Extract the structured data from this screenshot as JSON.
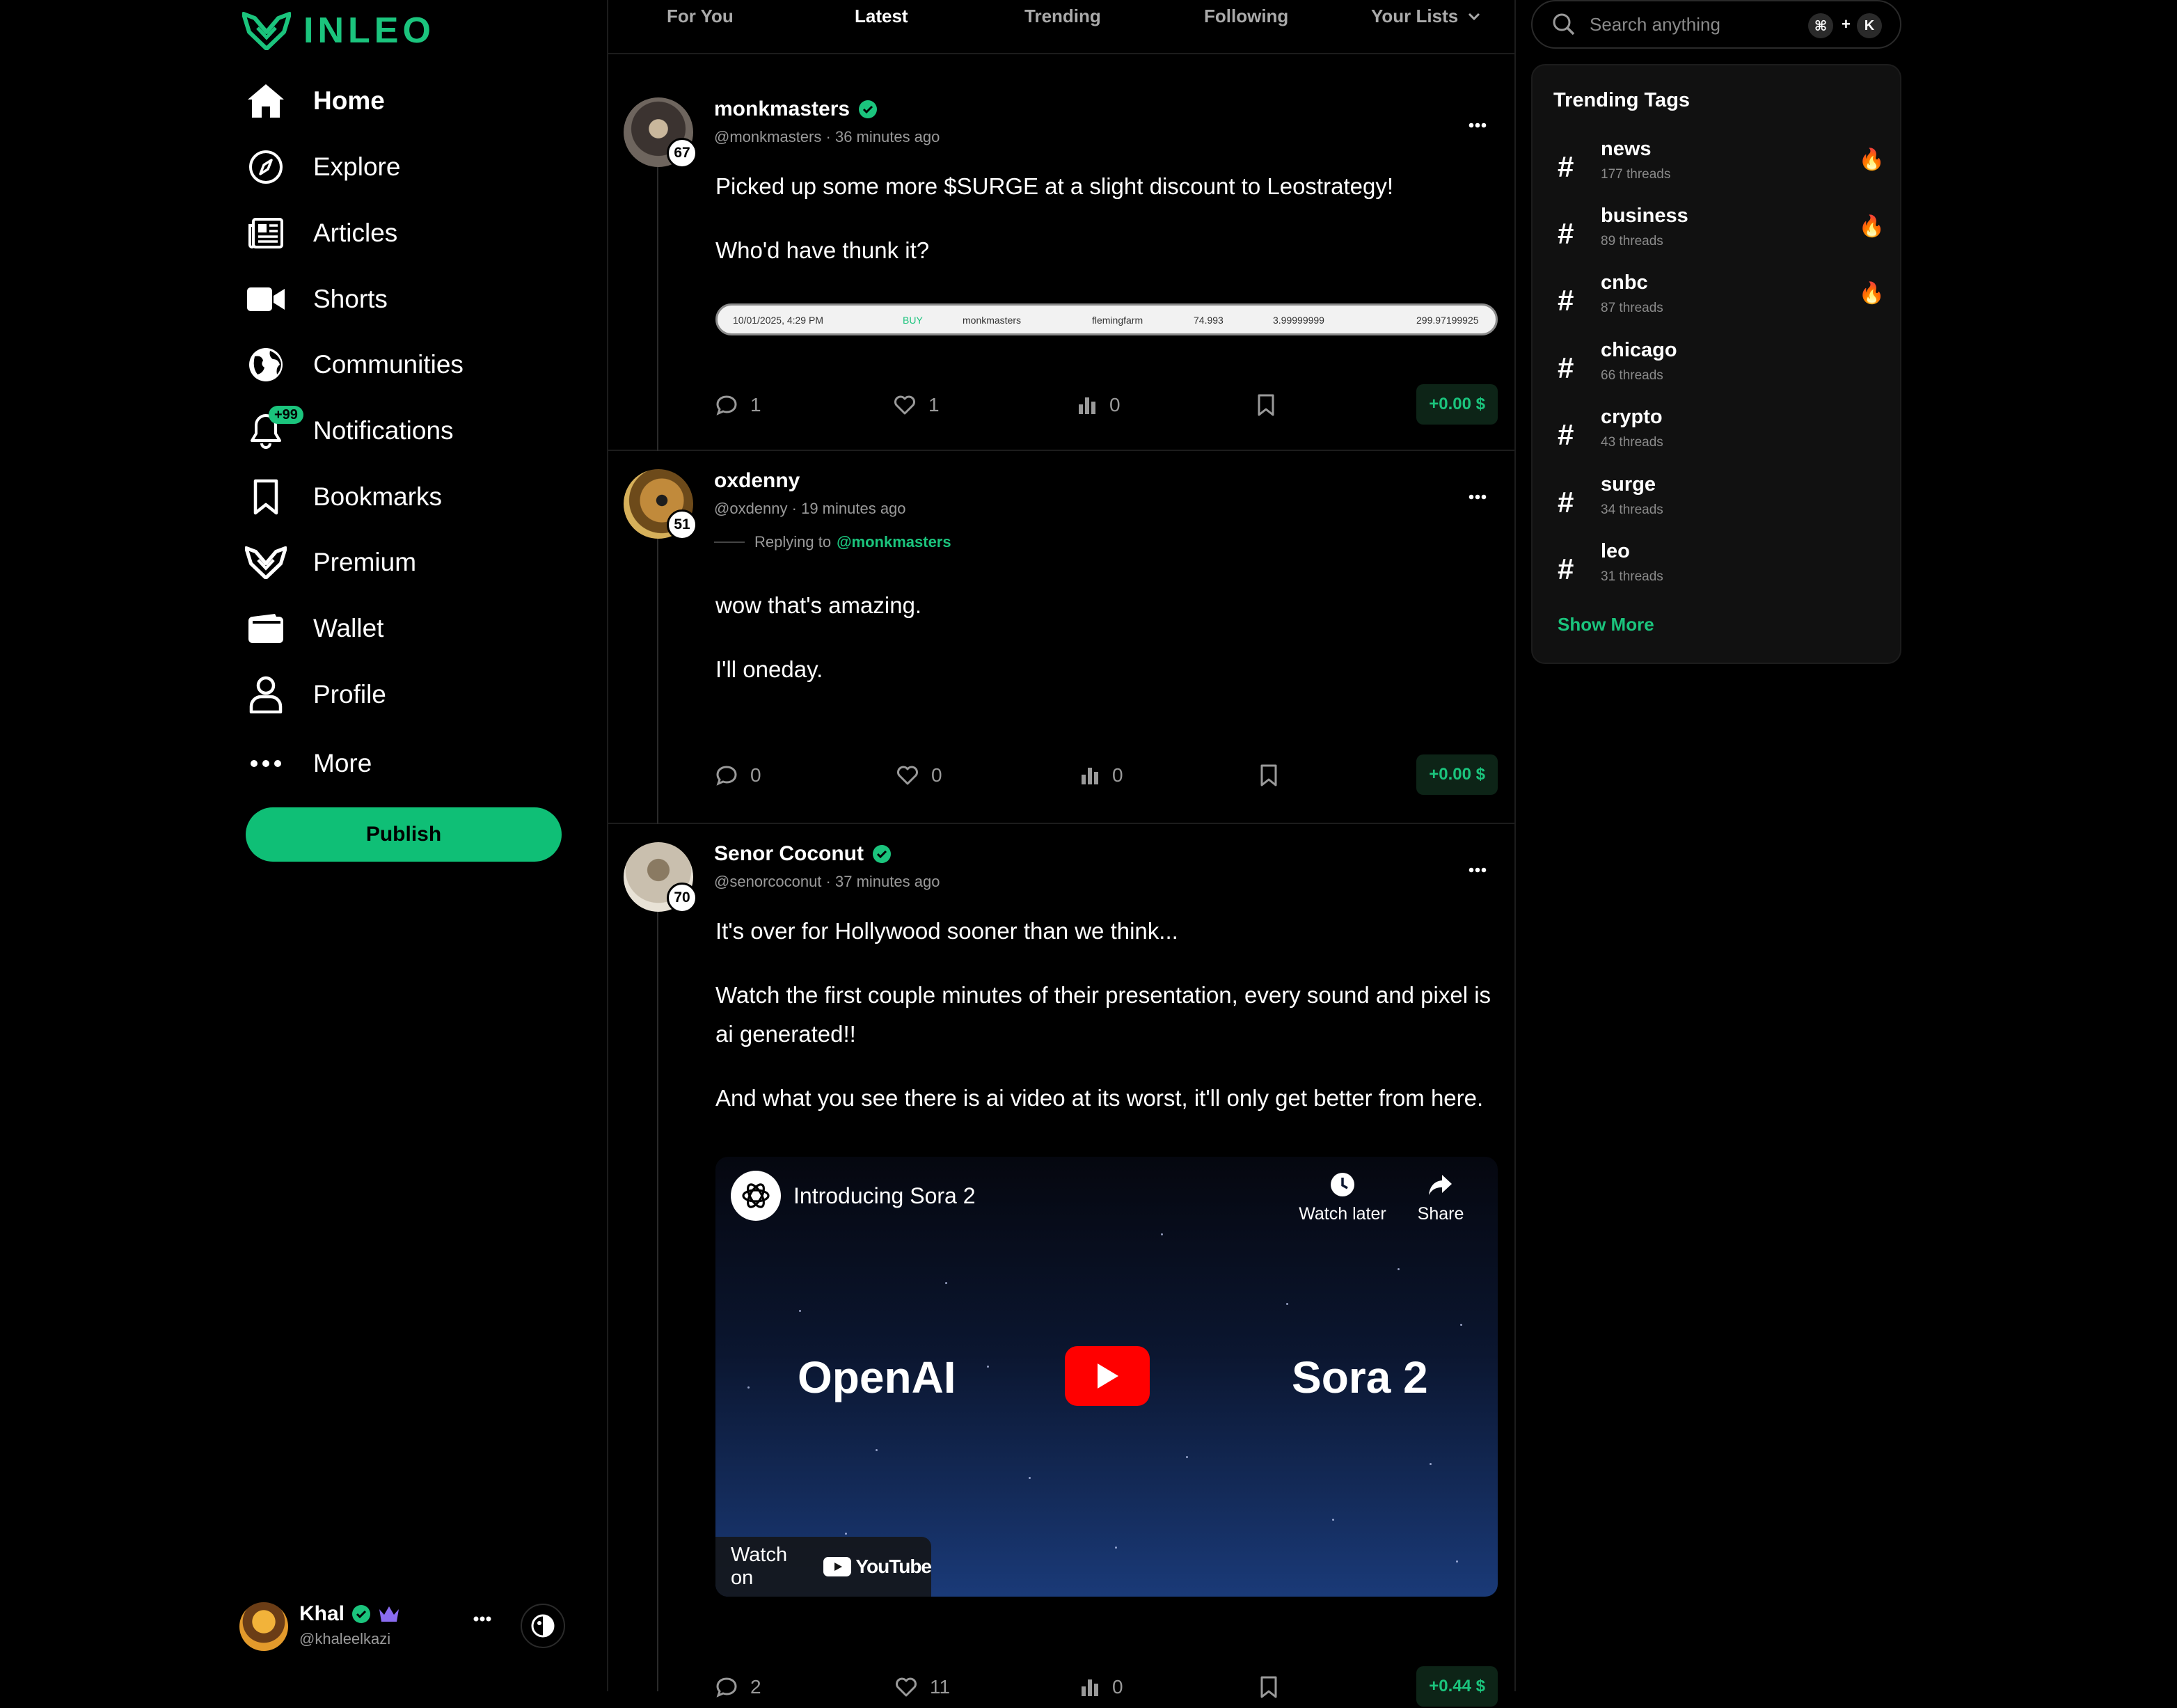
{
  "brand": {
    "name": "INLEO",
    "accent": "#1bc47d"
  },
  "nav": {
    "items": [
      {
        "label": "Home",
        "icon": "home-icon"
      },
      {
        "label": "Explore",
        "icon": "compass-icon"
      },
      {
        "label": "Articles",
        "icon": "newspaper-icon"
      },
      {
        "label": "Shorts",
        "icon": "video-camera-icon"
      },
      {
        "label": "Communities",
        "icon": "globe-icon"
      },
      {
        "label": "Notifications",
        "icon": "bell-icon",
        "badge": "+99"
      },
      {
        "label": "Bookmarks",
        "icon": "bookmark-icon"
      },
      {
        "label": "Premium",
        "icon": "leo-logo-icon"
      },
      {
        "label": "Wallet",
        "icon": "wallet-icon"
      },
      {
        "label": "Profile",
        "icon": "user-icon"
      },
      {
        "label": "More",
        "icon": "ellipsis-icon"
      }
    ],
    "publish_label": "Publish"
  },
  "current_user": {
    "name": "Khal",
    "handle": "@khaleelkazi"
  },
  "tabs": [
    "For You",
    "Latest",
    "Trending",
    "Following",
    "Your Lists"
  ],
  "posts": [
    {
      "author": "monkmasters",
      "level": "67",
      "handle": "@monkmasters",
      "time": "36 minutes ago",
      "paragraphs": [
        "Picked up some more $SURGE at a slight discount to Leostrategy!",
        "Who'd have thunk it?"
      ],
      "trade": {
        "date": "10/01/2025, 4:29 PM",
        "side": "BUY",
        "buyer": "monkmasters",
        "seller": "flemingfarm",
        "price": "74.993",
        "qty": "3.99999999",
        "total": "299.97199925"
      },
      "comments": "1",
      "likes": "1",
      "views": "0",
      "earnings": "+0.00 $"
    },
    {
      "author": "oxdenny",
      "level": "51",
      "handle": "@oxdenny",
      "time": "19 minutes ago",
      "replying_prefix": "Replying to",
      "replying_to": "@monkmasters",
      "paragraphs": [
        "wow that's amazing.",
        "I'll oneday."
      ],
      "comments": "0",
      "likes": "0",
      "views": "0",
      "earnings": "+0.00 $"
    },
    {
      "author": "Senor Coconut",
      "level": "70",
      "handle": "@senorcoconut",
      "time": "37 minutes ago",
      "paragraphs": [
        "It's over for Hollywood sooner than we think...",
        "Watch the first couple minutes of their presentation, every sound and pixel is ai generated!!",
        "And what you see there is ai video at its worst, it'll only get better from here."
      ],
      "video": {
        "title": "Introducing Sora 2",
        "watch_later": "Watch later",
        "share": "Share",
        "left_text": "OpenAI",
        "right_text": "Sora 2",
        "watch_on": "Watch on",
        "platform": "YouTube"
      },
      "comments": "2",
      "likes": "11",
      "views": "0",
      "earnings": "+0.44 $"
    }
  ],
  "search": {
    "placeholder": "Search anything",
    "shortcut_mod": "⌘",
    "shortcut_plus": "+",
    "shortcut_key": "K"
  },
  "trending": {
    "title": "Trending Tags",
    "tags": [
      {
        "name": "news",
        "count": "177 threads",
        "hot": true
      },
      {
        "name": "business",
        "count": "89 threads",
        "hot": true
      },
      {
        "name": "cnbc",
        "count": "87 threads",
        "hot": true
      },
      {
        "name": "chicago",
        "count": "66 threads",
        "hot": false
      },
      {
        "name": "crypto",
        "count": "43 threads",
        "hot": false
      },
      {
        "name": "surge",
        "count": "34 threads",
        "hot": false
      },
      {
        "name": "leo",
        "count": "31 threads",
        "hot": false
      }
    ],
    "show_more": "Show More"
  }
}
